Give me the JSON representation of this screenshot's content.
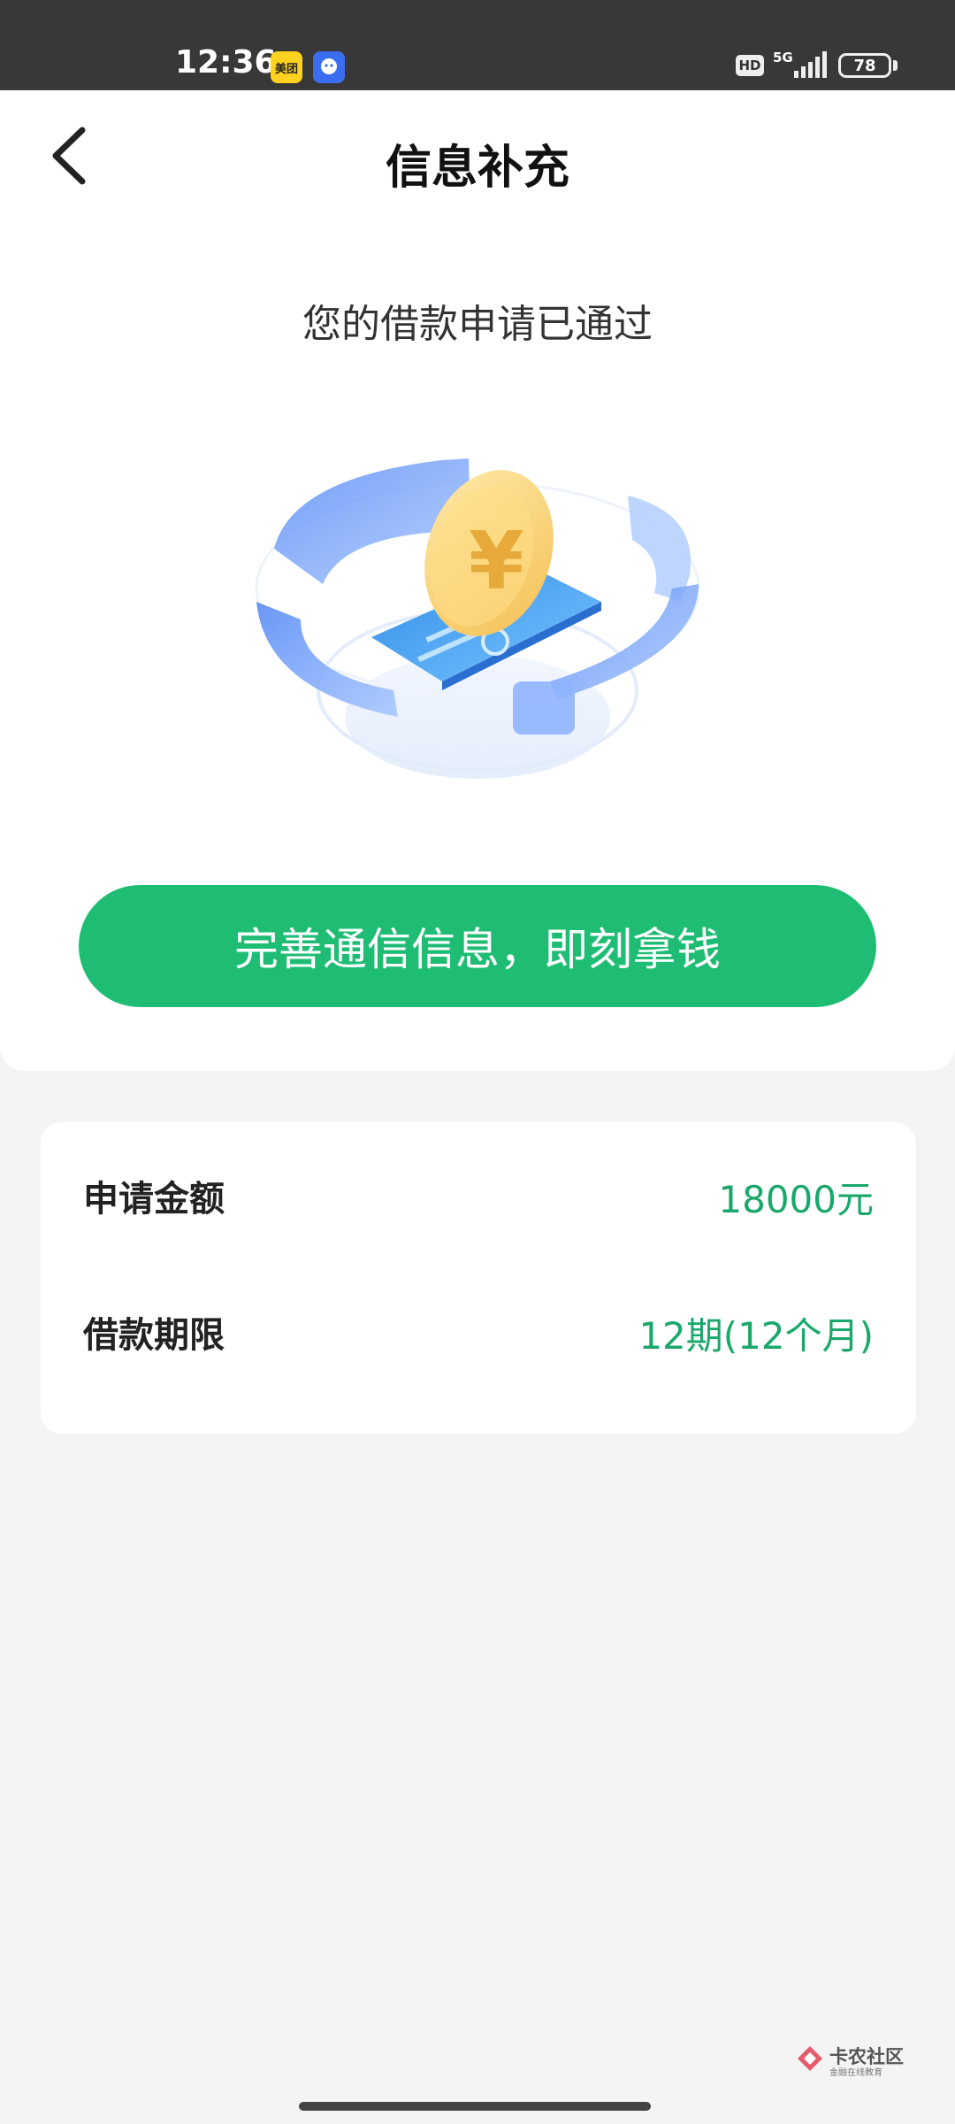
{
  "status_bar": {
    "time": "12:36",
    "app1_label": "美团",
    "hd": "HD",
    "network": "5G",
    "battery": "78"
  },
  "nav": {
    "title": "信息补充",
    "back_icon": "chevron-left-icon"
  },
  "result": {
    "message": "您的借款申请已通过",
    "illustration_icon": "coin-phone-icon",
    "cta_label": "完善通信信息，即刻拿钱"
  },
  "details": {
    "amount_label": "申请金额",
    "amount_value": "18000元",
    "term_label": "借款期限",
    "term_value": "12期(12个月)"
  },
  "watermark": {
    "title": "卡农社区",
    "subtitle": "金融在线教育"
  },
  "colors": {
    "accent_green": "#1fbd74",
    "value_green": "#1aa86a",
    "status_bar_bg": "#383838",
    "page_bg": "#f4f4f4"
  }
}
